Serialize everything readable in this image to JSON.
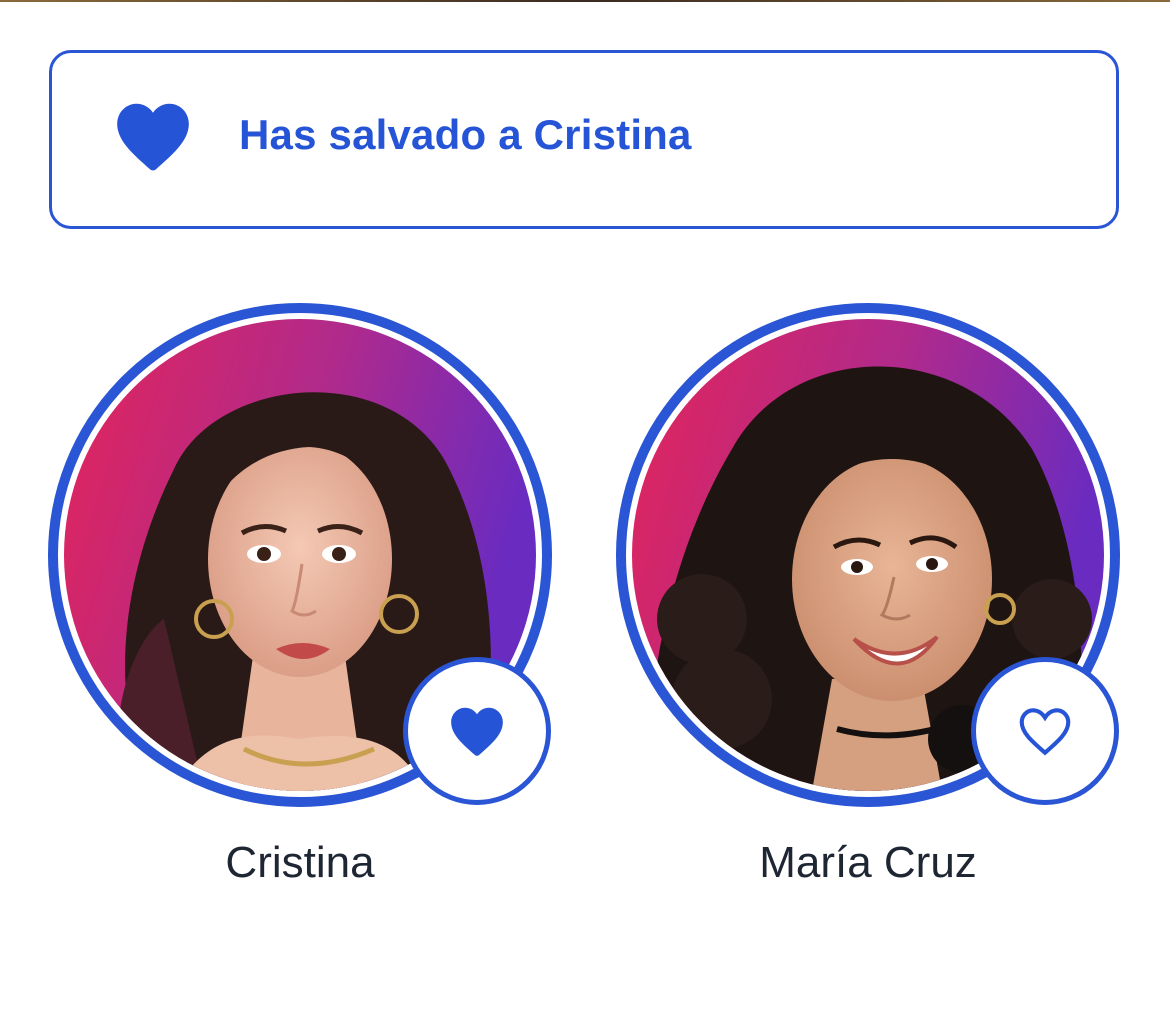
{
  "banner": {
    "icon": "heart-filled-icon",
    "text": "Has salvado a Cristina",
    "accent_color": "#2654d6"
  },
  "candidates": [
    {
      "name": "Cristina",
      "saved": true,
      "button_icon": "heart-filled-icon"
    },
    {
      "name": "María Cruz",
      "saved": false,
      "button_icon": "heart-outline-icon"
    }
  ],
  "colors": {
    "accent": "#2a55d4",
    "name_text": "#1f2633",
    "photo_bg_start": "#e0245e",
    "photo_bg_end": "#6a2bc0"
  }
}
